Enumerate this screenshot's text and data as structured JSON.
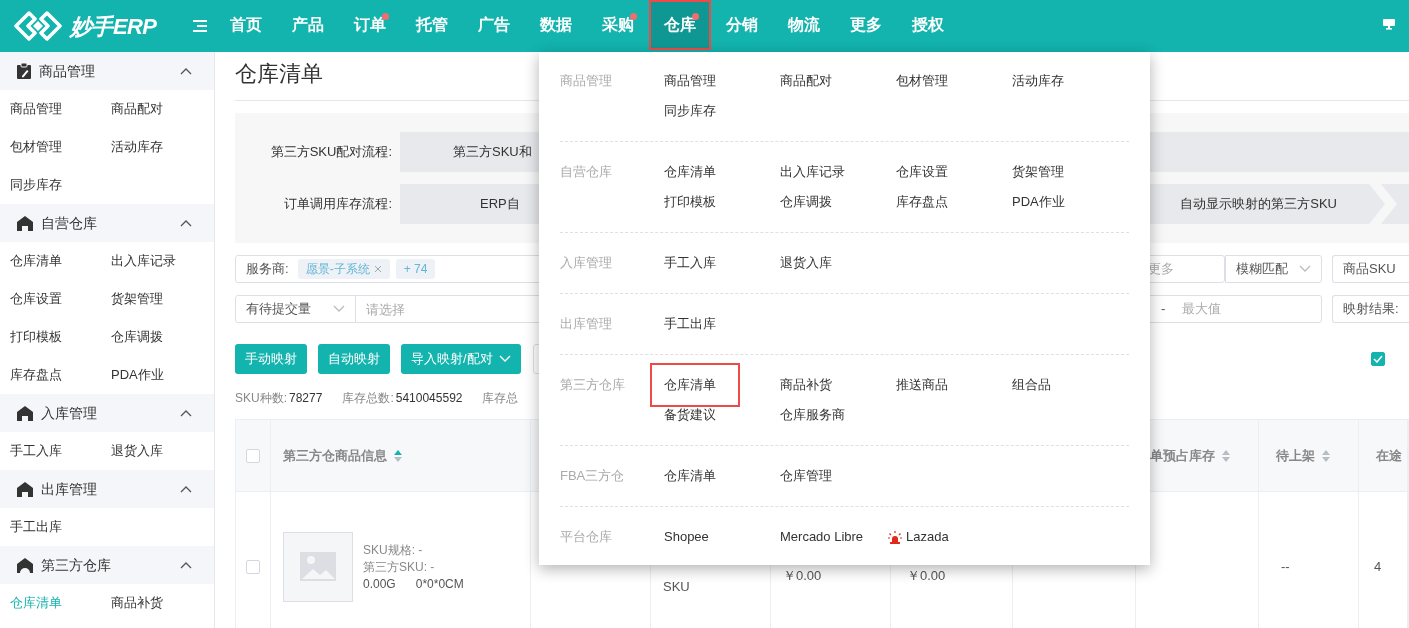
{
  "header": {
    "logo_text": "妙手ERP",
    "nav": [
      {
        "label": "首页",
        "badge": false,
        "selected": false
      },
      {
        "label": "产品",
        "badge": false,
        "selected": false
      },
      {
        "label": "订单",
        "badge": true,
        "selected": false
      },
      {
        "label": "托管",
        "badge": false,
        "selected": false
      },
      {
        "label": "广告",
        "badge": false,
        "selected": false
      },
      {
        "label": "数据",
        "badge": false,
        "selected": false
      },
      {
        "label": "采购",
        "badge": true,
        "selected": false
      },
      {
        "label": "仓库",
        "badge": true,
        "selected": true
      },
      {
        "label": "分销",
        "badge": false,
        "selected": false
      },
      {
        "label": "物流",
        "badge": false,
        "selected": false
      },
      {
        "label": "更多",
        "badge": false,
        "selected": false
      },
      {
        "label": "授权",
        "badge": false,
        "selected": false
      }
    ]
  },
  "sidebar": {
    "groups": [
      {
        "title": "商品管理",
        "expanded": true,
        "items": [
          {
            "label": "商品管理",
            "selected": false
          },
          {
            "label": "商品配对",
            "selected": false
          },
          {
            "label": "包材管理",
            "selected": false
          },
          {
            "label": "活动库存",
            "selected": false
          },
          {
            "label": "同步库存",
            "selected": false
          }
        ]
      },
      {
        "title": "自营仓库",
        "expanded": true,
        "items": [
          {
            "label": "仓库清单",
            "selected": false
          },
          {
            "label": "出入库记录",
            "selected": false
          },
          {
            "label": "仓库设置",
            "selected": false
          },
          {
            "label": "货架管理",
            "selected": false
          },
          {
            "label": "打印模板",
            "selected": false
          },
          {
            "label": "仓库调拨",
            "selected": false
          },
          {
            "label": "库存盘点",
            "selected": false
          },
          {
            "label": "PDA作业",
            "selected": false
          }
        ]
      },
      {
        "title": "入库管理",
        "expanded": true,
        "items": [
          {
            "label": "手工入库",
            "selected": false
          },
          {
            "label": "退货入库",
            "selected": false
          }
        ]
      },
      {
        "title": "出库管理",
        "expanded": true,
        "items": [
          {
            "label": "手工出库",
            "selected": false
          }
        ]
      },
      {
        "title": "第三方仓库",
        "expanded": true,
        "items": [
          {
            "label": "仓库清单",
            "selected": true
          },
          {
            "label": "商品补货",
            "selected": false
          }
        ]
      }
    ]
  },
  "page": {
    "title": "仓库清单",
    "flows": [
      {
        "label": "第三方SKU配对流程:",
        "steps": [
          "第三方SKU和"
        ]
      },
      {
        "label": "订单调用库存流程:",
        "steps": [
          "ERP自",
          "自动显示映射的第三方SKU"
        ]
      }
    ],
    "filters": {
      "service_label": "服务商:",
      "tags": [
        {
          "label": "愿景-子系统",
          "removable": true
        },
        {
          "label": "+ 74",
          "removable": false
        }
      ],
      "more_placeholder": "更多",
      "match_select": "模糊匹配",
      "sku_select": "商品SKU",
      "pending_select": "有待提交量",
      "pending_placeholder": "请选择",
      "range_separator": "-",
      "max_placeholder": "最大值",
      "mapping_label": "映射结果:"
    },
    "actions": [
      {
        "label": "手动映射",
        "dropdown": false
      },
      {
        "label": "自动映射",
        "dropdown": false
      },
      {
        "label": "导入映射/配对",
        "dropdown": true
      }
    ],
    "display_option": {
      "checked": true
    },
    "stats": [
      {
        "label": "SKU种数:",
        "value": "78277"
      },
      {
        "label": "库存总数:",
        "value": "5410045592"
      },
      {
        "label": "库存总"
      }
    ],
    "table": {
      "header_checked": false,
      "columns": [
        {
          "label": "第三方仓商品信息",
          "sort_active": true
        },
        {
          "label": "单预占库存",
          "sort_active": false
        },
        {
          "label": "待上架",
          "sort_active": false
        },
        {
          "label": "在途"
        }
      ],
      "rows": [
        {
          "checked": false,
          "spec": "SKU规格: -",
          "third_sku": "第三方SKU: -",
          "weight": "0.00G",
          "dims": "0*0*0CM",
          "column_3": "SKU",
          "column_4": "￥0.00",
          "column_5": "￥0.00",
          "pending_shelf": "--",
          "in_transit": "4"
        }
      ]
    }
  },
  "mega_menu": {
    "sections": [
      {
        "title": "商品管理",
        "items": [
          {
            "label": "商品管理",
            "selected": false
          },
          {
            "label": "商品配对",
            "selected": false
          },
          {
            "label": "包材管理",
            "selected": false
          },
          {
            "label": "活动库存",
            "selected": false
          },
          {
            "label": "同步库存",
            "selected": false
          }
        ]
      },
      {
        "title": "自营仓库",
        "items": [
          {
            "label": "仓库清单",
            "selected": false
          },
          {
            "label": "出入库记录",
            "selected": false
          },
          {
            "label": "仓库设置",
            "selected": false
          },
          {
            "label": "货架管理",
            "selected": false
          },
          {
            "label": "打印模板",
            "selected": false
          },
          {
            "label": "仓库调拨",
            "selected": false
          },
          {
            "label": "库存盘点",
            "selected": false
          },
          {
            "label": "PDA作业",
            "selected": false
          }
        ]
      },
      {
        "title": "入库管理",
        "items": [
          {
            "label": "手工入库",
            "selected": false
          },
          {
            "label": "退货入库",
            "selected": false
          }
        ]
      },
      {
        "title": "出库管理",
        "items": [
          {
            "label": "手工出库",
            "selected": false
          }
        ]
      },
      {
        "title": "第三方仓库",
        "items": [
          {
            "label": "仓库清单",
            "selected": true
          },
          {
            "label": "商品补货",
            "selected": false
          },
          {
            "label": "推送商品",
            "selected": false
          },
          {
            "label": "组合品",
            "selected": false
          },
          {
            "label": "备货建议",
            "selected": false
          },
          {
            "label": "仓库服务商",
            "selected": false
          }
        ]
      },
      {
        "title": "FBA三方仓",
        "items": [
          {
            "label": "仓库清单",
            "selected": false
          },
          {
            "label": "仓库管理",
            "selected": false
          }
        ]
      },
      {
        "title": "平台仓库",
        "items": [
          {
            "label": "Shopee",
            "selected": false,
            "flagged": false
          },
          {
            "label": "Mercado Libre",
            "selected": false,
            "flagged": false
          },
          {
            "label": "Lazada",
            "selected": false,
            "flagged": true
          }
        ]
      }
    ]
  }
}
